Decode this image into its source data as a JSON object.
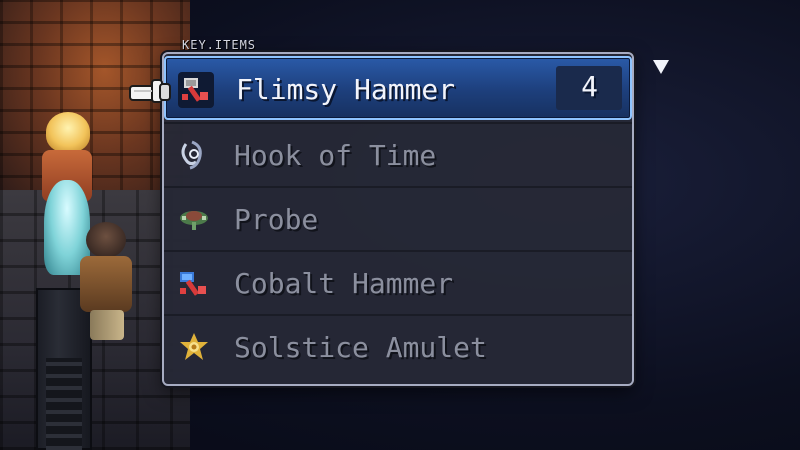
{
  "menu": {
    "category_label": "KEY.ITEMS",
    "items": [
      {
        "label": "Flimsy Hammer",
        "count": "4",
        "icon": "hammer-red-icon",
        "selected": true
      },
      {
        "label": "Hook of Time",
        "icon": "hook-icon",
        "selected": false
      },
      {
        "label": "Probe",
        "icon": "probe-icon",
        "selected": false
      },
      {
        "label": "Cobalt Hammer",
        "icon": "hammer-blue-icon",
        "selected": false
      },
      {
        "label": "Solstice Amulet",
        "icon": "amulet-icon",
        "selected": false
      }
    ],
    "pointer_icon": "hand-pointer-icon",
    "scroll_indicator_icon": "triangle-down-icon"
  },
  "colors": {
    "selection": "#1d3f7c",
    "selection_border": "#8fc4ff",
    "panel": "#262936",
    "text_selected": "#f2f4fb",
    "text_dim": "#8b8f9e"
  }
}
